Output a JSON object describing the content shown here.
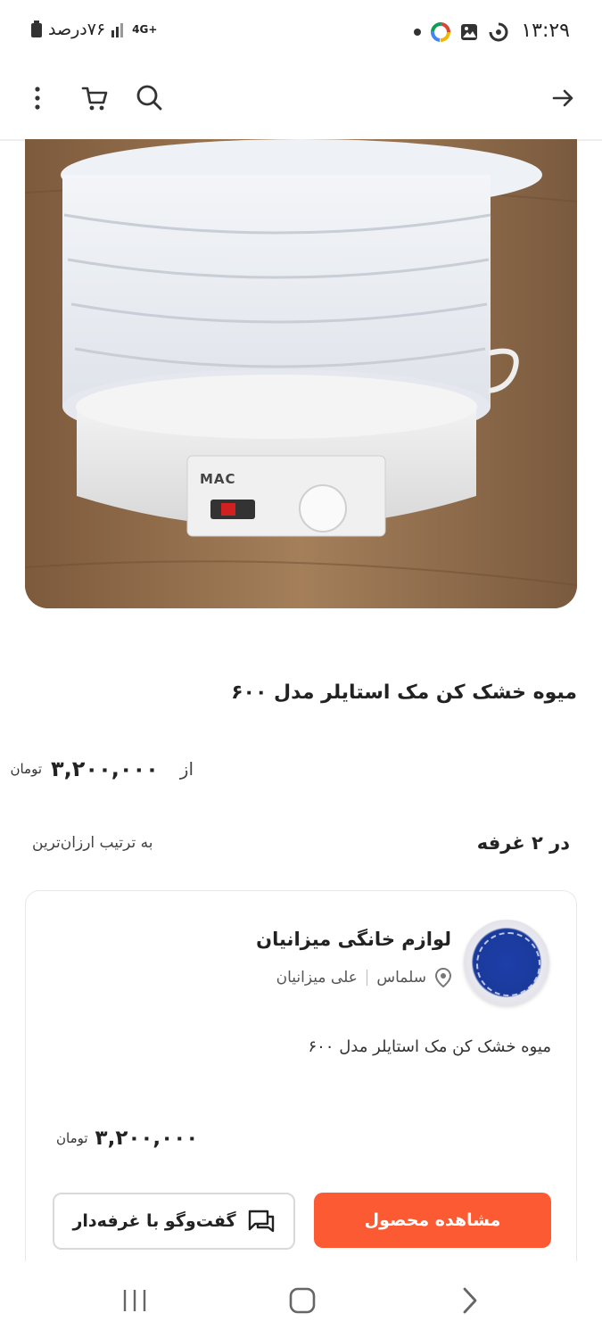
{
  "status_bar": {
    "time": "۱۳:۲۹",
    "battery": "۷۶درصد",
    "network": "4G+"
  },
  "app_bar": {
    "icons": [
      "back-arrow-icon",
      "search-icon",
      "cart-icon",
      "more-vert-icon"
    ]
  },
  "product": {
    "image_alt": "food dehydrator",
    "brand_on_image": "MAC",
    "title": "میوه خشک کن مک استایلر مدل ۶۰۰",
    "from_label": "از",
    "price": "۳,۲۰۰,۰۰۰",
    "currency": "تومان"
  },
  "stores": {
    "count_label": "در ۲ غرفه",
    "sort_label": "به ترتیب ارزان‌ترین"
  },
  "store_card": {
    "name": "لوازم خانگی میزانیان",
    "city": "سلماس",
    "owner": "علی میزانیان",
    "product_name": "میوه خشک کن مک استایلر مدل ۶۰۰",
    "price": "۳,۲۰۰,۰۰۰",
    "currency": "تومان",
    "view_button": "مشاهده محصول",
    "chat_button": "گفت‌وگو با غرفه‌دار"
  },
  "colors": {
    "accent": "#fb5a33",
    "logo_blue": "#1a3a9c"
  }
}
